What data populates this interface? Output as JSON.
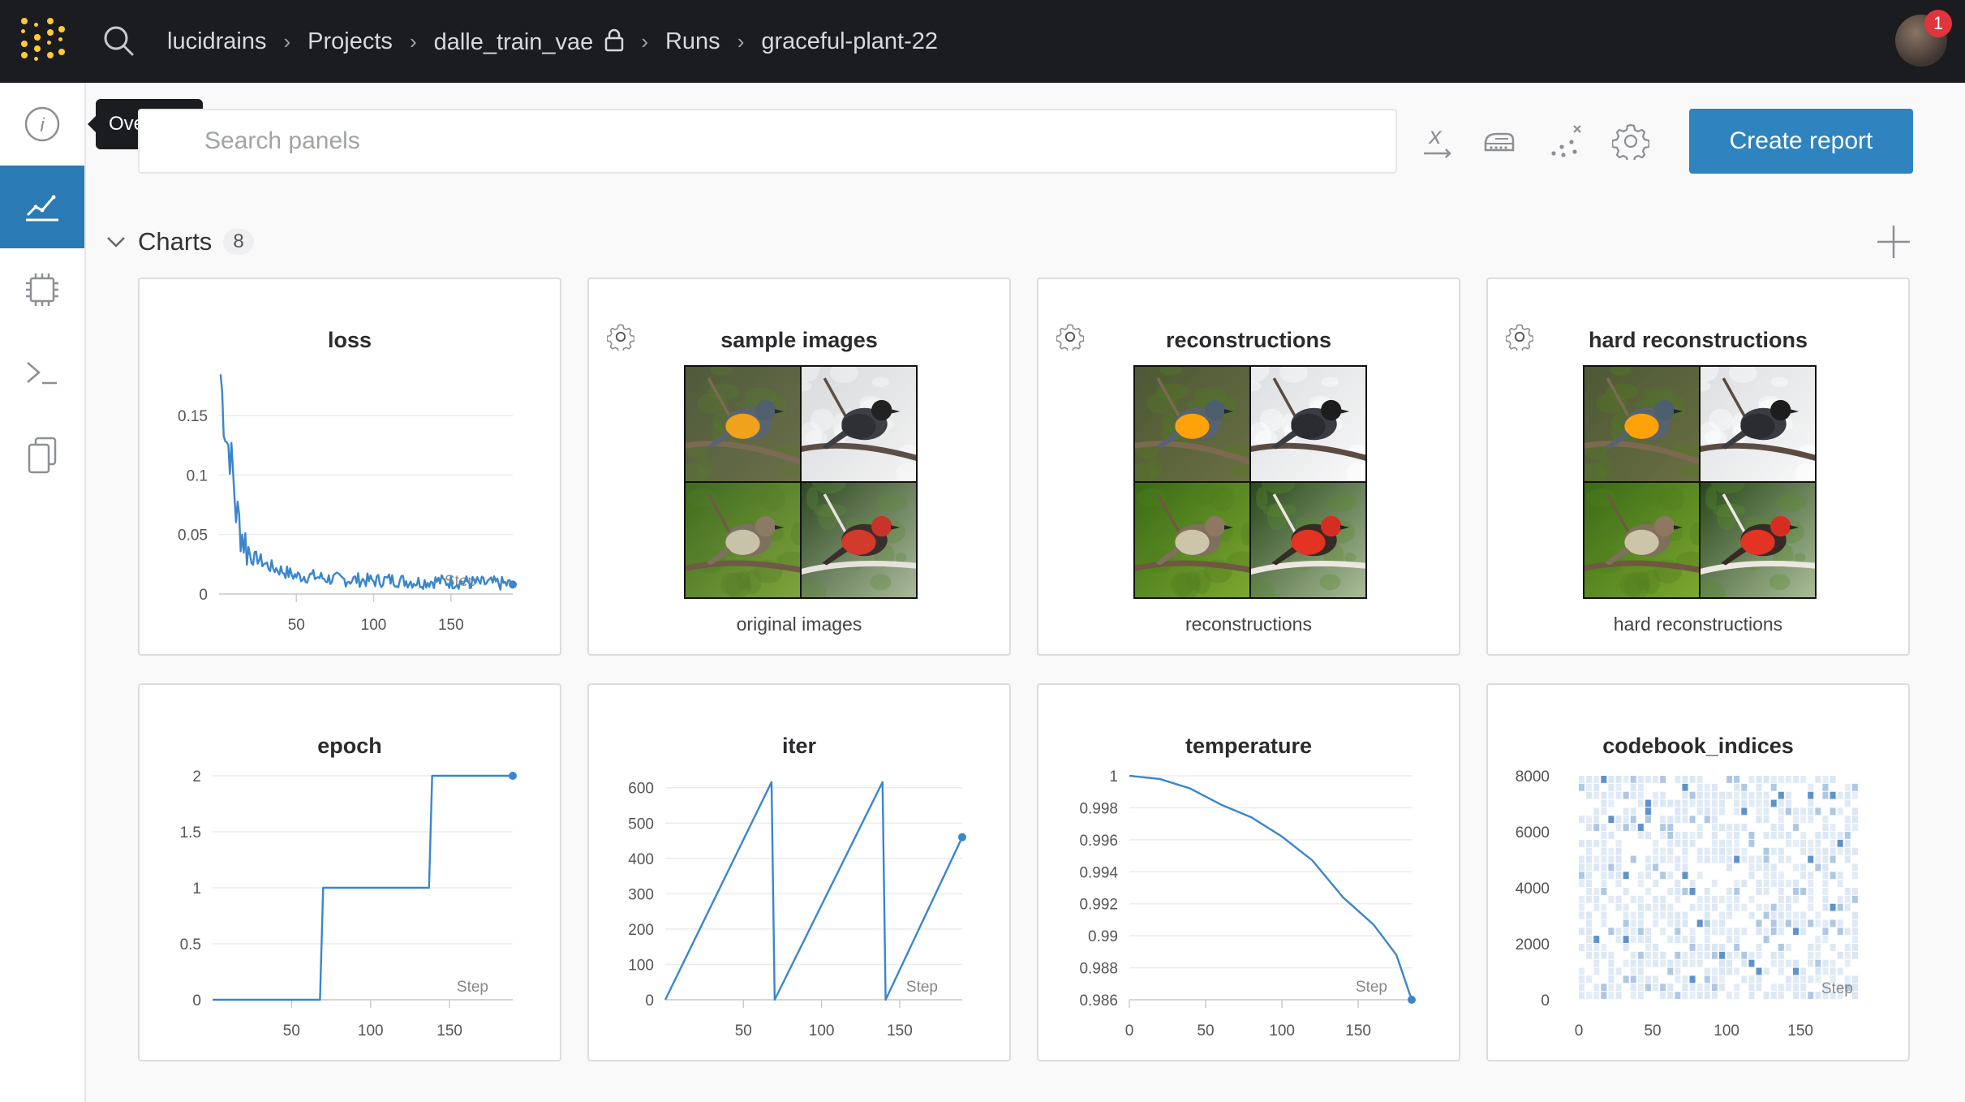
{
  "breadcrumb": [
    "lucidrains",
    "Projects",
    "dalle_train_vae",
    "Runs",
    "graceful-plant-22"
  ],
  "notifications_count": "1",
  "sidebar": {
    "tooltip": "Overview",
    "items": [
      {
        "icon": "info-icon"
      },
      {
        "icon": "line-chart-icon",
        "active": true
      },
      {
        "icon": "cpu-chip-icon"
      },
      {
        "icon": "terminal-icon"
      },
      {
        "icon": "files-icon"
      }
    ]
  },
  "toolbar": {
    "search_placeholder": "Search panels",
    "create_report_label": "Create report",
    "tools": [
      "x-axis-icon",
      "smoothing-icon",
      "outliers-icon",
      "settings-gear-icon"
    ]
  },
  "section": {
    "title": "Charts",
    "count": "8"
  },
  "colors": {
    "accent": "#2f83bf",
    "line": "#3a86cc",
    "active_sidebar": "#2a7ab3"
  },
  "image_panels": [
    {
      "title": "sample images",
      "caption": "original images"
    },
    {
      "title": "reconstructions",
      "caption": "reconstructions"
    },
    {
      "title": "hard reconstructions",
      "caption": "hard reconstructions"
    }
  ],
  "chart_data": [
    {
      "type": "line",
      "title": "loss",
      "xlabel": "Step",
      "xticks": [
        50,
        100,
        150
      ],
      "yticks": [
        0,
        0.05,
        0.1,
        0.15
      ],
      "ytick_labels": [
        "0",
        "0.05",
        "0.1",
        "0.15"
      ],
      "xlim": [
        0,
        190
      ],
      "ylim": [
        0,
        0.18
      ],
      "series": [
        {
          "x": [
            1,
            3,
            5,
            7,
            9,
            11,
            13,
            15,
            18,
            21,
            25,
            30,
            35,
            40,
            50,
            60,
            70,
            80,
            90,
            100,
            110,
            120,
            130,
            140,
            150,
            160,
            170,
            180,
            190
          ],
          "values": [
            0.185,
            0.15,
            0.13,
            0.12,
            0.1,
            0.07,
            0.06,
            0.05,
            0.04,
            0.03,
            0.03,
            0.025,
            0.022,
            0.02,
            0.015,
            0.015,
            0.013,
            0.012,
            0.012,
            0.011,
            0.012,
            0.011,
            0.01,
            0.011,
            0.01,
            0.01,
            0.009,
            0.009,
            0.008
          ]
        }
      ]
    },
    {
      "type": "line",
      "title": "epoch",
      "xlabel": "Step",
      "xticks": [
        50,
        100,
        150
      ],
      "yticks": [
        0,
        0.5,
        1,
        1.5,
        2
      ],
      "ytick_labels": [
        "0",
        "0.5",
        "1",
        "1.5",
        "2"
      ],
      "xlim": [
        0,
        190
      ],
      "ylim": [
        0,
        2
      ],
      "series": [
        {
          "x": [
            0,
            68,
            70,
            137,
            139,
            190
          ],
          "values": [
            0,
            0,
            1,
            1,
            2,
            2
          ]
        }
      ]
    },
    {
      "type": "line",
      "title": "iter",
      "xlabel": "Step",
      "xticks": [
        50,
        100,
        150
      ],
      "yticks": [
        0,
        100,
        200,
        300,
        400,
        500,
        600
      ],
      "ytick_labels": [
        "0",
        "100",
        "200",
        "300",
        "400",
        "500",
        "600"
      ],
      "xlim": [
        0,
        190
      ],
      "ylim": [
        0,
        620
      ],
      "series": [
        {
          "x": [
            0,
            68,
            70,
            139,
            141,
            190
          ],
          "values": [
            0,
            616,
            0,
            616,
            0,
            460
          ]
        }
      ]
    },
    {
      "type": "line",
      "title": "temperature",
      "xlabel": "Step",
      "xticks": [
        0,
        50,
        100,
        150
      ],
      "yticks": [
        0.986,
        0.988,
        0.99,
        0.992,
        0.994,
        0.996,
        0.998,
        1
      ],
      "ytick_labels": [
        "0.986",
        "0.988",
        "0.99",
        "0.992",
        "0.994",
        "0.996",
        "0.998",
        "1"
      ],
      "xlim": [
        0,
        185
      ],
      "ylim": [
        0.986,
        1
      ],
      "series": [
        {
          "x": [
            0,
            20,
            40,
            60,
            70,
            80,
            100,
            120,
            140,
            160,
            175,
            185
          ],
          "values": [
            1,
            0.9998,
            0.9992,
            0.9982,
            0.9978,
            0.9974,
            0.9962,
            0.9947,
            0.9924,
            0.9907,
            0.9888,
            0.986
          ]
        }
      ]
    },
    {
      "type": "heatmap",
      "title": "codebook_indices",
      "xlabel": "Step",
      "xticks": [
        0,
        50,
        100,
        150
      ],
      "yticks": [
        0,
        2000,
        4000,
        6000,
        8000
      ],
      "ytick_labels": [
        "0",
        "2000",
        "4000",
        "6000",
        "8000"
      ],
      "xlim": [
        0,
        190
      ],
      "ylim": [
        0,
        8000
      ]
    }
  ]
}
